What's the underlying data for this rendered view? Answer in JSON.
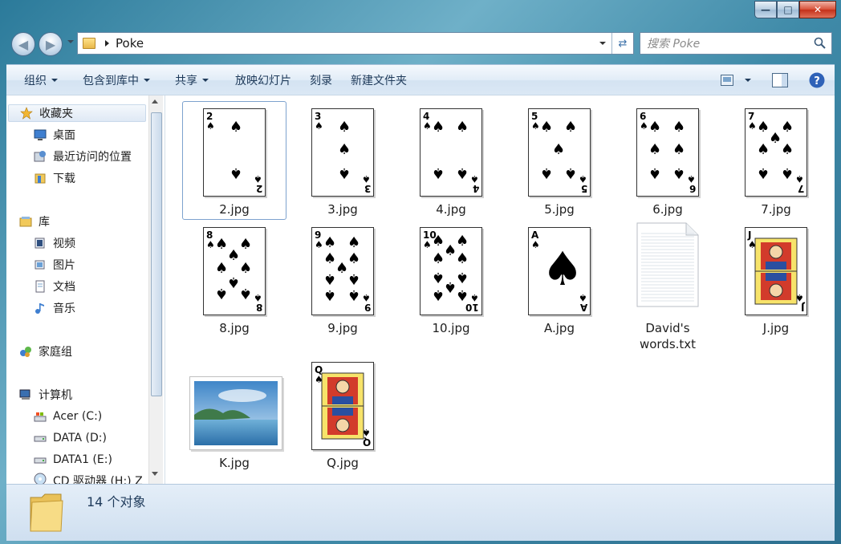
{
  "window": {
    "caption_buttons": {
      "minimize": "—",
      "maximize": "□",
      "close": "✕"
    }
  },
  "navigation": {
    "address_path": "Poke",
    "search_placeholder": "搜索 Poke"
  },
  "toolbar": {
    "organize": "组织",
    "include_in_library": "包含到库中",
    "share": "共享",
    "slideshow": "放映幻灯片",
    "burn": "刻录",
    "new_folder": "新建文件夹"
  },
  "sidebar": {
    "favorites": "收藏夹",
    "desktop": "桌面",
    "recent_places": "最近访问的位置",
    "downloads": "下载",
    "libraries": "库",
    "videos": "视频",
    "pictures": "图片",
    "documents": "文档",
    "music": "音乐",
    "homegroup": "家庭组",
    "computer": "计算机",
    "drive_c": "Acer (C:)",
    "drive_d": "DATA (D:)",
    "drive_e": "DATA1 (E:)",
    "drive_h": "CD 驱动器 (H:) Z"
  },
  "files": [
    {
      "name": "2.jpg",
      "rank": "2",
      "pips": 2,
      "type": "card"
    },
    {
      "name": "3.jpg",
      "rank": "3",
      "pips": 3,
      "type": "card"
    },
    {
      "name": "4.jpg",
      "rank": "4",
      "pips": 4,
      "type": "card"
    },
    {
      "name": "5.jpg",
      "rank": "5",
      "pips": 5,
      "type": "card"
    },
    {
      "name": "6.jpg",
      "rank": "6",
      "pips": 6,
      "type": "card"
    },
    {
      "name": "7.jpg",
      "rank": "7",
      "pips": 7,
      "type": "card"
    },
    {
      "name": "8.jpg",
      "rank": "8",
      "pips": 8,
      "type": "card"
    },
    {
      "name": "9.jpg",
      "rank": "9",
      "pips": 9,
      "type": "card"
    },
    {
      "name": "10.jpg",
      "rank": "10",
      "pips": 10,
      "type": "card"
    },
    {
      "name": "A.jpg",
      "rank": "A",
      "pips": 1,
      "type": "ace"
    },
    {
      "name": "David's\nwords.txt",
      "type": "text"
    },
    {
      "name": "J.jpg",
      "rank": "J",
      "type": "face"
    },
    {
      "name": "K.jpg",
      "type": "photo"
    },
    {
      "name": "Q.jpg",
      "rank": "Q",
      "type": "face"
    }
  ],
  "status": {
    "count_text": "14 个对象"
  },
  "colors": {
    "accent": "#3b6ea8",
    "toolbar_text": "#1e3a5a",
    "selection_border": "#7da2ce"
  }
}
